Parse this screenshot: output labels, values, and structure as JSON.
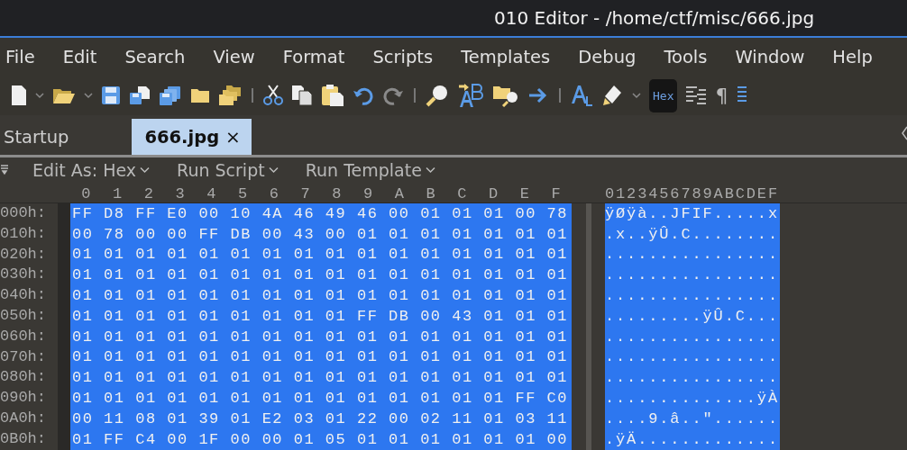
{
  "window": {
    "title": "010 Editor - /home/ctf/misc/666.jpg"
  },
  "menu": [
    "File",
    "Edit",
    "Search",
    "View",
    "Format",
    "Scripts",
    "Templates",
    "Debug",
    "Tools",
    "Window",
    "Help"
  ],
  "toolbar": {
    "hex_button": "Hex",
    "hex_on": true,
    "pilcrow": "¶"
  },
  "tabs": [
    {
      "label": "Startup",
      "selected": false
    },
    {
      "label": "666.jpg",
      "selected": true,
      "close": "×"
    }
  ],
  "editor_bar": [
    "Edit As: Hex",
    "Run Script",
    "Run Template"
  ],
  "hex_view": {
    "columns": [
      "0",
      "1",
      "2",
      "3",
      "4",
      "5",
      "6",
      "7",
      "8",
      "9",
      "A",
      "B",
      "C",
      "D",
      "E",
      "F"
    ],
    "ascii_header": "0123456789ABCDEF",
    "rows": [
      {
        "offset": "000h:",
        "bytes": [
          "FF",
          "D8",
          "FF",
          "E0",
          "00",
          "10",
          "4A",
          "46",
          "49",
          "46",
          "00",
          "01",
          "01",
          "01",
          "00",
          "78"
        ],
        "ascii": "ÿØÿà..JFIF.....x",
        "selected": true
      },
      {
        "offset": "010h:",
        "bytes": [
          "00",
          "78",
          "00",
          "00",
          "FF",
          "DB",
          "00",
          "43",
          "00",
          "01",
          "01",
          "01",
          "01",
          "01",
          "01",
          "01"
        ],
        "ascii": ".x..ÿÛ.C........",
        "selected": true
      },
      {
        "offset": "020h:",
        "bytes": [
          "01",
          "01",
          "01",
          "01",
          "01",
          "01",
          "01",
          "01",
          "01",
          "01",
          "01",
          "01",
          "01",
          "01",
          "01",
          "01"
        ],
        "ascii": "................",
        "selected": true
      },
      {
        "offset": "030h:",
        "bytes": [
          "01",
          "01",
          "01",
          "01",
          "01",
          "01",
          "01",
          "01",
          "01",
          "01",
          "01",
          "01",
          "01",
          "01",
          "01",
          "01"
        ],
        "ascii": "................",
        "selected": true
      },
      {
        "offset": "040h:",
        "bytes": [
          "01",
          "01",
          "01",
          "01",
          "01",
          "01",
          "01",
          "01",
          "01",
          "01",
          "01",
          "01",
          "01",
          "01",
          "01",
          "01"
        ],
        "ascii": "................",
        "selected": true
      },
      {
        "offset": "050h:",
        "bytes": [
          "01",
          "01",
          "01",
          "01",
          "01",
          "01",
          "01",
          "01",
          "01",
          "FF",
          "DB",
          "00",
          "43",
          "01",
          "01",
          "01"
        ],
        "ascii": ".........ÿÛ.C...",
        "selected": true
      },
      {
        "offset": "060h:",
        "bytes": [
          "01",
          "01",
          "01",
          "01",
          "01",
          "01",
          "01",
          "01",
          "01",
          "01",
          "01",
          "01",
          "01",
          "01",
          "01",
          "01"
        ],
        "ascii": "................",
        "selected": true
      },
      {
        "offset": "070h:",
        "bytes": [
          "01",
          "01",
          "01",
          "01",
          "01",
          "01",
          "01",
          "01",
          "01",
          "01",
          "01",
          "01",
          "01",
          "01",
          "01",
          "01"
        ],
        "ascii": "................",
        "selected": true
      },
      {
        "offset": "080h:",
        "bytes": [
          "01",
          "01",
          "01",
          "01",
          "01",
          "01",
          "01",
          "01",
          "01",
          "01",
          "01",
          "01",
          "01",
          "01",
          "01",
          "01"
        ],
        "ascii": "................",
        "selected": true
      },
      {
        "offset": "090h:",
        "bytes": [
          "01",
          "01",
          "01",
          "01",
          "01",
          "01",
          "01",
          "01",
          "01",
          "01",
          "01",
          "01",
          "01",
          "01",
          "FF",
          "C0"
        ],
        "ascii": "..............ÿÀ",
        "selected": true
      },
      {
        "offset": "0A0h:",
        "bytes": [
          "00",
          "11",
          "08",
          "01",
          "39",
          "01",
          "E2",
          "03",
          "01",
          "22",
          "00",
          "02",
          "11",
          "01",
          "03",
          "11"
        ],
        "ascii": "....9.â..\"......",
        "selected": true
      },
      {
        "offset": "0B0h:",
        "bytes": [
          "01",
          "FF",
          "C4",
          "00",
          "1F",
          "00",
          "00",
          "01",
          "05",
          "01",
          "01",
          "01",
          "01",
          "01",
          "01",
          "00"
        ],
        "ascii": ".ÿÄ.............",
        "selected": true
      }
    ]
  }
}
